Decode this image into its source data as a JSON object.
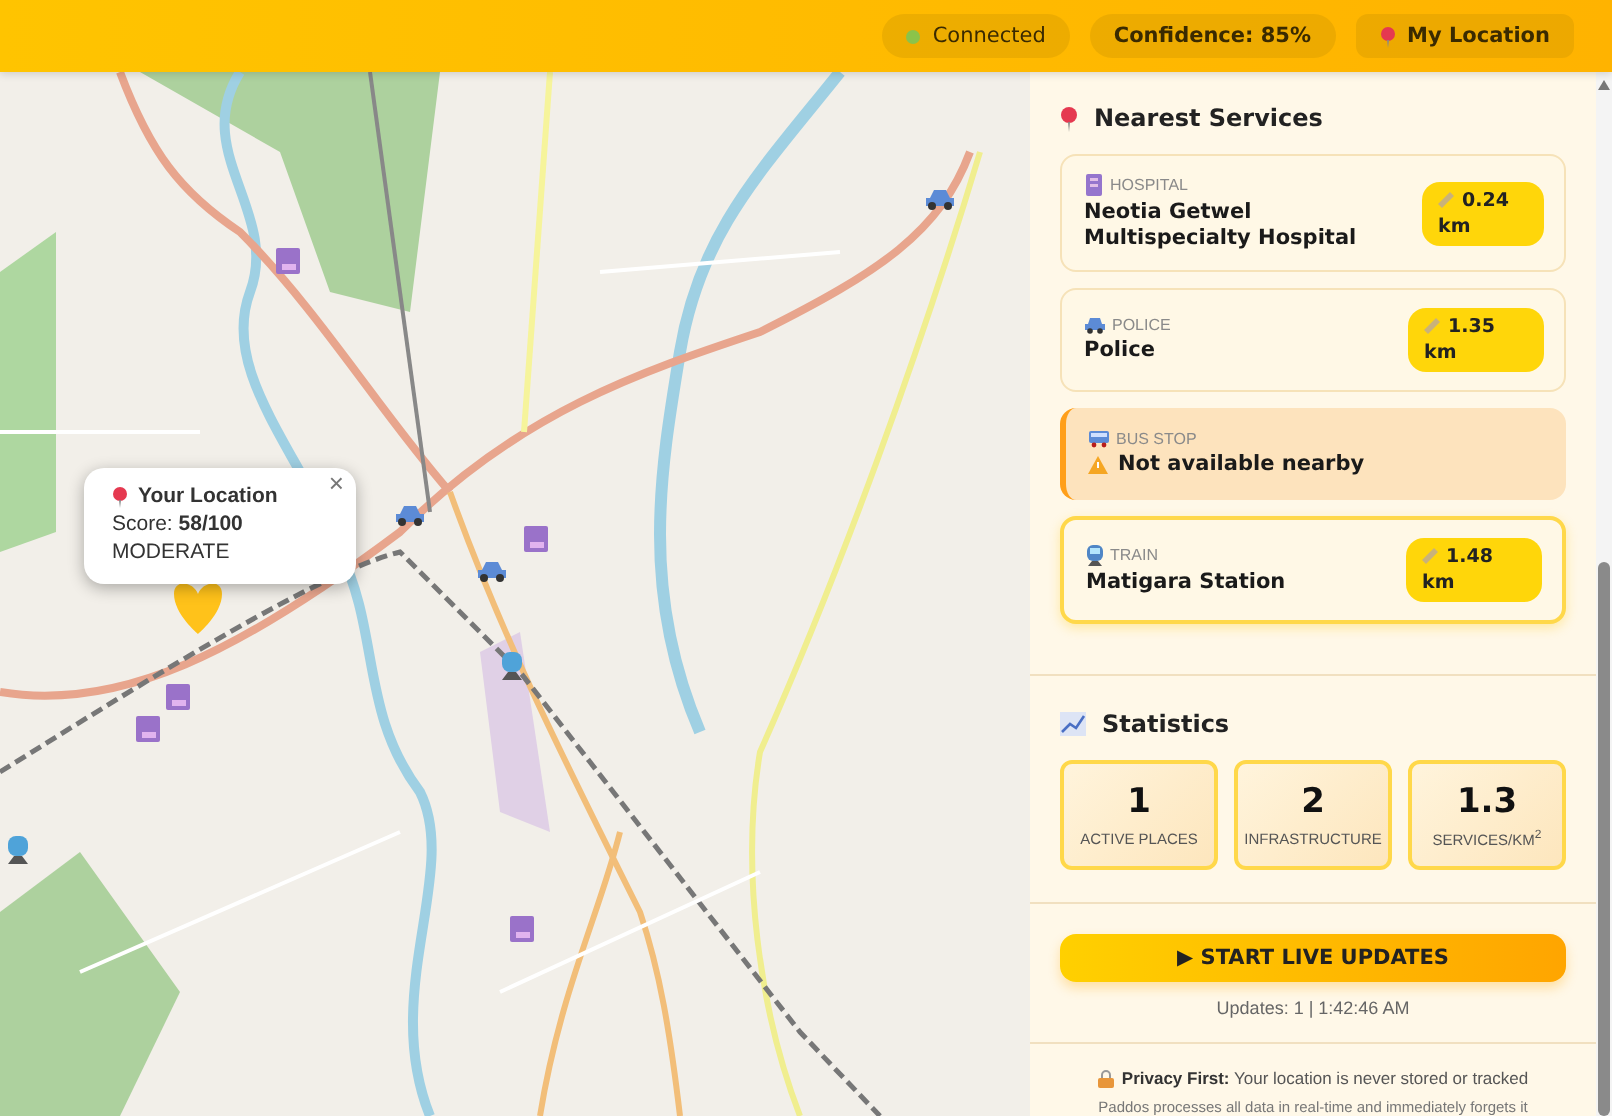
{
  "header": {
    "status": {
      "label": "Connected",
      "color": "#8bc34a"
    },
    "confidence": "Confidence: 85%",
    "location_button": "My Location"
  },
  "map": {
    "popup": {
      "title": "Your Location",
      "score": "Score: **58/100**",
      "level": "MODERATE",
      "close": "×"
    }
  },
  "nearest_services": {
    "title": "Nearest Services",
    "items": [
      {
        "kind": "hospital",
        "category": "HOSPITAL",
        "name": "Neotia Getwel Multispecialty Hospital",
        "distance": "0.24 km",
        "available": true,
        "selected": false
      },
      {
        "kind": "police",
        "category": "POLICE",
        "name": "Police",
        "distance": "1.35 km",
        "available": true,
        "selected": false
      },
      {
        "kind": "bus",
        "category": "BUS STOP",
        "name": "Not available nearby",
        "available": false,
        "selected": false
      },
      {
        "kind": "train",
        "category": "TRAIN",
        "name": "Matigara Station",
        "distance": "1.48 km",
        "available": true,
        "selected": true
      }
    ]
  },
  "statistics": {
    "title": "Statistics",
    "tiles": [
      {
        "value": "1",
        "label": "ACTIVE PLACES"
      },
      {
        "value": "2",
        "label": "INFRASTRUCTURE"
      },
      {
        "value": "1.3",
        "label": "SERVICES/KM$^{2}$"
      }
    ]
  },
  "live_button": "▶ START LIVE UPDATES",
  "updates": "Updates: 1 | 1:42:46 AM",
  "privacy": {
    "note": "**Privacy First:** Your location is never stored or tracked",
    "detail": "Paddos processes all data in real-time and immediately forgets it"
  }
}
